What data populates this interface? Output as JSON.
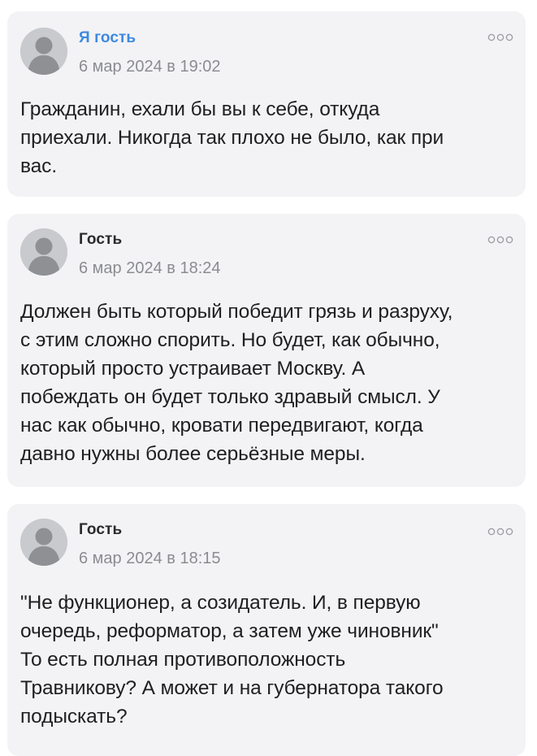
{
  "comments": [
    {
      "author": "Я гость",
      "is_self": true,
      "date": "6 мар 2024 в 19:02",
      "text": "Гражданин, ехали бы вы к себе, откуда\nприехали. Никогда так плохо не было, как при\nвас."
    },
    {
      "author": "Гость",
      "is_self": false,
      "date": "6 мар 2024 в 18:24",
      "text": "Должен быть который победит грязь и разруху,\nс этим сложно спорить. Но будет, как обычно,\nкоторый просто устраивает Москву. А\nпобеждать он будет только здравый смысл. У\nнас как обычно, кровати передвигают, когда\nдавно нужны более серьёзные меры."
    },
    {
      "author": "Гость",
      "is_self": false,
      "date": "6 мар 2024 в 18:15",
      "text": "\"Не функционер, а созидатель. И, в первую\nочередь, реформатор, а затем уже чиновник\"\nТо есть полная противоположность\nТравникову? А может и на губернатора такого\nподыскать?"
    }
  ],
  "colors": {
    "self_author": "#3d8ae0",
    "author": "#2a2a2c",
    "date": "#8b8c90",
    "card_bg": "#f3f3f5",
    "avatar_bg": "#c9cacd"
  },
  "icons": {
    "avatar": "user-avatar-placeholder-icon",
    "more": "more-options-icon"
  }
}
